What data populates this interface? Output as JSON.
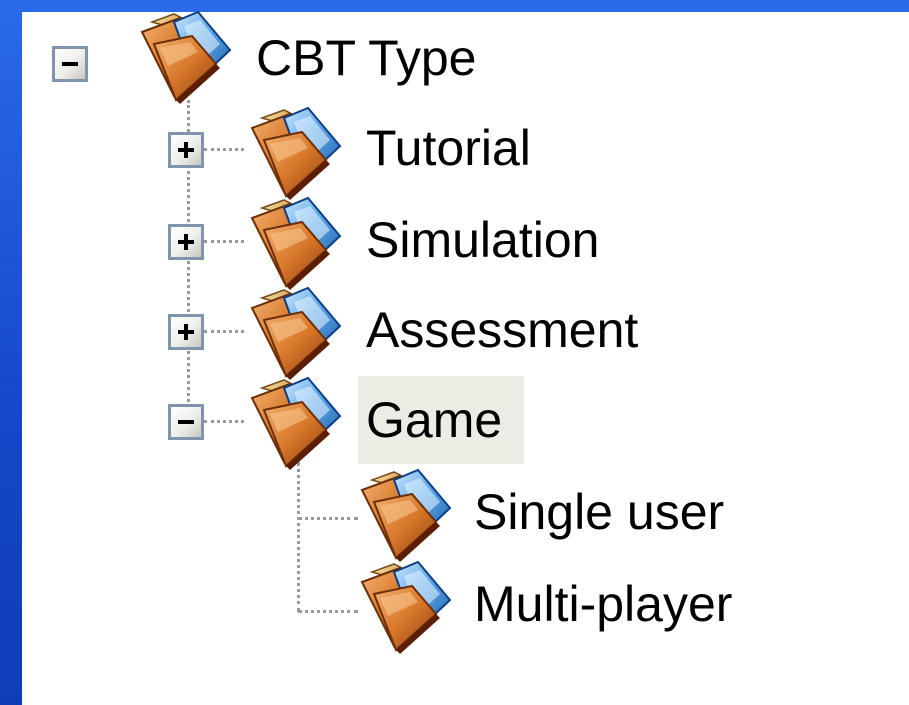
{
  "tree": {
    "root": {
      "label": "CBT Type",
      "expanded": true,
      "icon": "open-folder-icon",
      "children": [
        {
          "label": "Tutorial",
          "expanded": false,
          "icon": "open-folder-icon"
        },
        {
          "label": "Simulation",
          "expanded": false,
          "icon": "open-folder-icon"
        },
        {
          "label": "Assessment",
          "expanded": false,
          "icon": "open-folder-icon"
        },
        {
          "label": "Game",
          "expanded": true,
          "selected": true,
          "icon": "open-folder-icon",
          "children": [
            {
              "label": "Single user",
              "icon": "open-folder-icon"
            },
            {
              "label": "Multi-player",
              "icon": "open-folder-icon"
            }
          ]
        }
      ]
    }
  },
  "colors": {
    "background": "#1a55d0",
    "panel": "#ffffff",
    "selection": "#ecebe4",
    "folder_orange": "#d8782a",
    "folder_blue": "#5ba6e6",
    "expander_border": "#7f94ad"
  }
}
